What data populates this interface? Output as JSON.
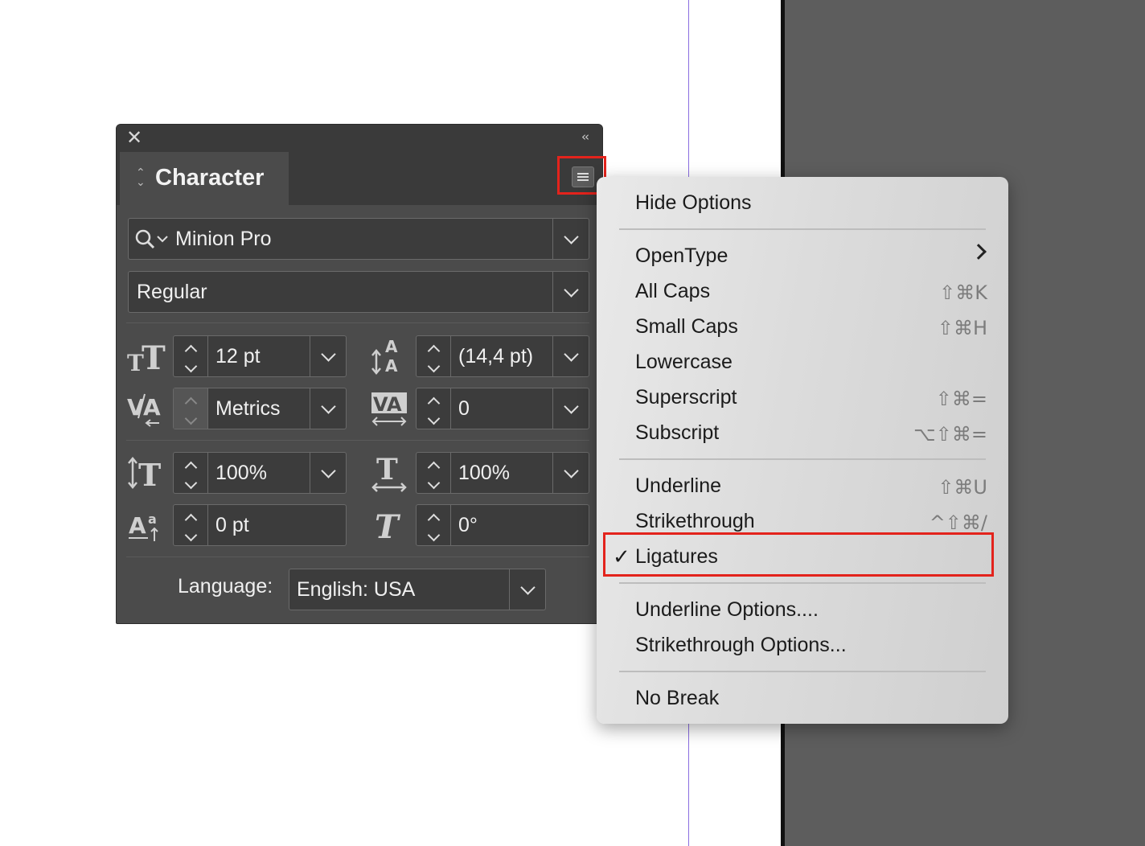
{
  "panel": {
    "title": "Character",
    "font_family": {
      "value": "Minion Pro"
    },
    "font_style": {
      "value": "Regular"
    },
    "font_size": {
      "value": "12 pt"
    },
    "leading": {
      "value": "(14,4 pt)"
    },
    "kerning": {
      "value": "Metrics"
    },
    "tracking": {
      "value": "0"
    },
    "vertical_scale": {
      "value": "100%"
    },
    "horizontal_scale": {
      "value": "100%"
    },
    "baseline_shift": {
      "value": "0 pt"
    },
    "skew": {
      "value": "0°"
    },
    "language": {
      "label": "Language:",
      "value": "English: USA"
    }
  },
  "menu": {
    "items": [
      {
        "label": "Hide Options",
        "shortcut": ""
      },
      {
        "label": "OpenType",
        "shortcut": ""
      },
      {
        "label": "All Caps",
        "shortcut": "⇧⌘K"
      },
      {
        "label": "Small Caps",
        "shortcut": "⇧⌘H"
      },
      {
        "label": "Lowercase",
        "shortcut": ""
      },
      {
        "label": "Superscript",
        "shortcut": "⇧⌘="
      },
      {
        "label": "Subscript",
        "shortcut": "⌥⇧⌘="
      },
      {
        "label": "Underline",
        "shortcut": "⇧⌘U"
      },
      {
        "label": "Strikethrough",
        "shortcut": "^⇧⌘/"
      },
      {
        "label": "Ligatures",
        "shortcut": "",
        "checked": true
      },
      {
        "label": "Underline Options....",
        "shortcut": ""
      },
      {
        "label": "Strikethrough Options...",
        "shortcut": ""
      },
      {
        "label": "No Break",
        "shortcut": ""
      }
    ],
    "check_mark": "✓"
  },
  "colors": {
    "panel_bg": "#4b4b4b",
    "highlight": "#e3231c",
    "pasteboard": "#5d5d5d",
    "guide": "#8a6de0"
  }
}
